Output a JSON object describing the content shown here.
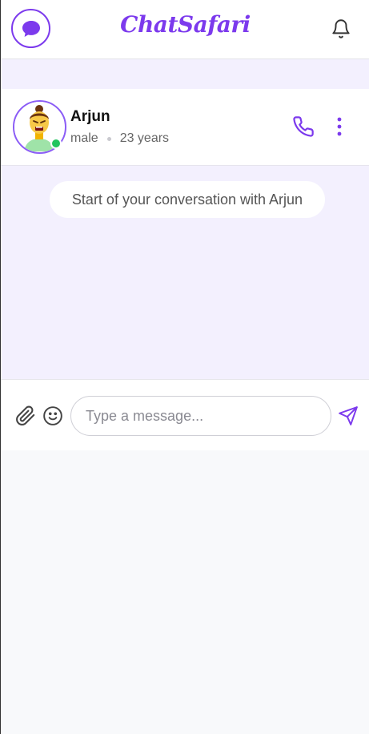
{
  "header": {
    "brand": "ChatSafari",
    "logo_icon": "chat-bubble-icon",
    "notifications_icon": "bell-icon"
  },
  "profile": {
    "name": "Arjun",
    "gender": "male",
    "age": "23 years",
    "status": "online",
    "call_icon": "phone-icon",
    "menu_icon": "more-vertical-icon"
  },
  "chat": {
    "start_notice": "Start of your conversation with Arjun"
  },
  "composer": {
    "placeholder": "Type a message...",
    "value": "",
    "attach_icon": "paperclip-icon",
    "emoji_icon": "smiley-icon",
    "send_icon": "send-icon"
  },
  "colors": {
    "accent": "#7c3aed",
    "chat_background": "#f3f0fe",
    "online": "#22c55e"
  }
}
